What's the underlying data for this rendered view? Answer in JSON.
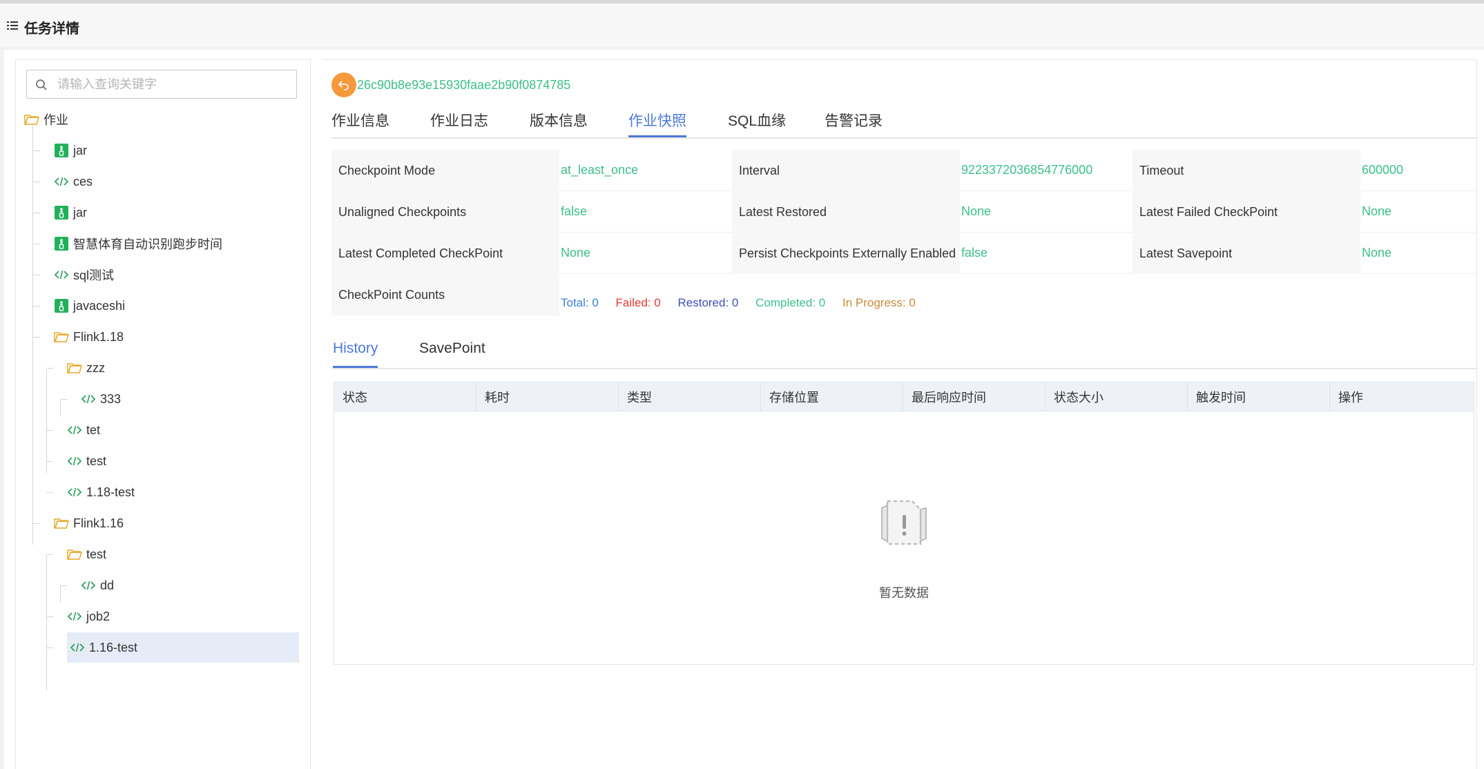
{
  "header": {
    "title": "任务详情",
    "menu_icon": "menu-list-icon"
  },
  "search": {
    "placeholder": "请输入查询关键字",
    "value": ""
  },
  "tree": {
    "root": "作业",
    "items": [
      {
        "label": "jar",
        "icon": "jar-file-icon",
        "level": 1
      },
      {
        "label": "ces",
        "icon": "code-icon",
        "level": 1
      },
      {
        "label": "jar",
        "icon": "jar-file-icon",
        "level": 1
      },
      {
        "label": "智慧体育自动识别跑步时间",
        "icon": "jar-file-icon",
        "level": 1
      },
      {
        "label": "sql测试",
        "icon": "code-icon",
        "level": 1
      },
      {
        "label": "javaceshi",
        "icon": "jar-file-icon",
        "level": 1
      },
      {
        "label": "Flink1.18",
        "icon": "folder-icon",
        "level": 1
      },
      {
        "label": "zzz",
        "icon": "folder-icon",
        "level": 2
      },
      {
        "label": "333",
        "icon": "code-icon",
        "level": 3
      },
      {
        "label": "tet",
        "icon": "code-icon",
        "level": 2
      },
      {
        "label": "test",
        "icon": "code-icon",
        "level": 2
      },
      {
        "label": "1.18-test",
        "icon": "code-icon",
        "level": 2
      },
      {
        "label": "Flink1.16",
        "icon": "folder-icon",
        "level": 1
      },
      {
        "label": "test",
        "icon": "folder-icon",
        "level": 2
      },
      {
        "label": "dd",
        "icon": "code-icon",
        "level": 3
      },
      {
        "label": "job2",
        "icon": "code-icon",
        "level": 2
      },
      {
        "label": "1.16-test",
        "icon": "code-icon",
        "level": 2,
        "selected": true
      }
    ]
  },
  "job": {
    "id": "26c90b8e93e15930faae2b90f0874785"
  },
  "tabs": [
    "作业信息",
    "作业日志",
    "版本信息",
    "作业快照",
    "SQL血缘",
    "告警记录"
  ],
  "active_tab": "作业快照",
  "checkpoint": {
    "rows": [
      [
        {
          "label": "Checkpoint Mode",
          "value": "at_least_once"
        },
        {
          "label": "Interval",
          "value": "9223372036854776000"
        },
        {
          "label": "Timeout",
          "value": "600000"
        }
      ],
      [
        {
          "label": "Unaligned Checkpoints",
          "value": "false"
        },
        {
          "label": "Latest Restored",
          "value": "None"
        },
        {
          "label": "Latest Failed CheckPoint",
          "value": "None"
        }
      ],
      [
        {
          "label": "Latest Completed CheckPoint",
          "value": "None"
        },
        {
          "label": "Persist Checkpoints Externally Enabled",
          "value": "false"
        },
        {
          "label": "Latest Savepoint",
          "value": "None"
        }
      ]
    ],
    "counts_label": "CheckPoint Counts",
    "counts": {
      "total": "Total: 0",
      "failed": "Failed: 0",
      "restored": "Restored: 0",
      "completed": "Completed: 0",
      "in_progress": "In Progress: 0"
    }
  },
  "subtabs": [
    "History",
    "SavePoint"
  ],
  "active_subtab": "History",
  "table": {
    "columns": [
      "状态",
      "耗时",
      "类型",
      "存储位置",
      "最后响应时间",
      "状态大小",
      "触发时间",
      "操作"
    ],
    "empty_text": "暂无数据"
  },
  "colors": {
    "accent": "#4d78d6",
    "value_green": "#3cbf8a",
    "back_button": "#f59a3c",
    "total": "#3a7fd5",
    "failed": "#e53935",
    "restored": "#3f4fb5",
    "completed": "#3cbf8a",
    "in_progress": "#c9893b"
  }
}
